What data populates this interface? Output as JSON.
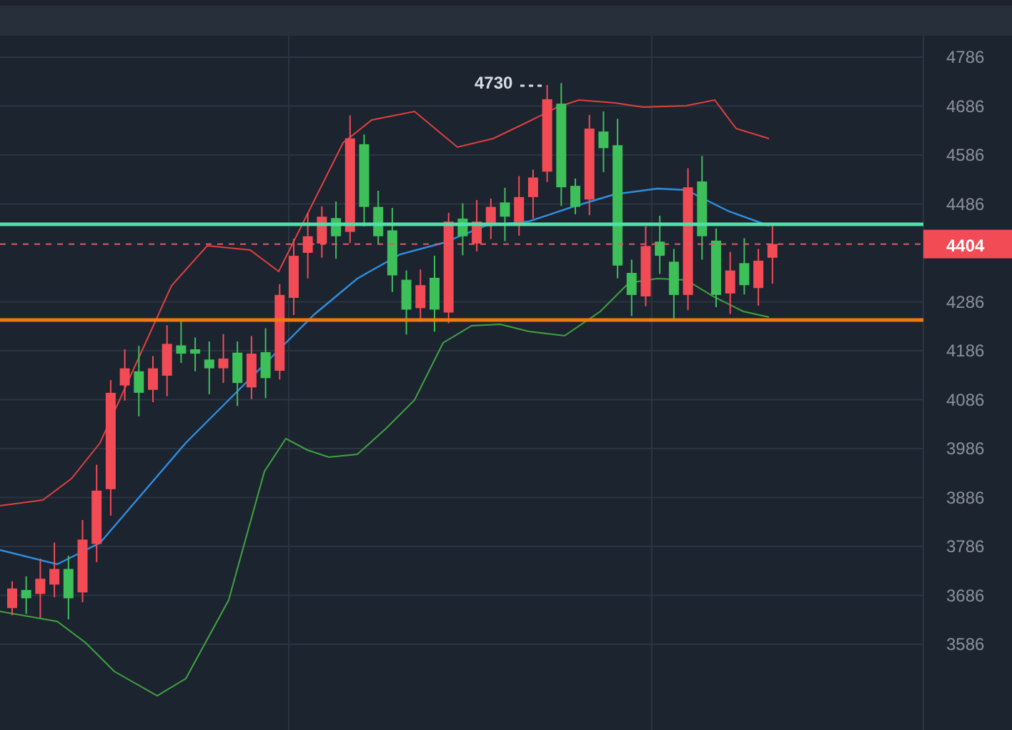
{
  "price_axis": {
    "ticks": [
      "4786",
      "4686",
      "4586",
      "4486",
      "4286",
      "4186",
      "4086",
      "3986",
      "3886",
      "3786",
      "3686",
      "3586"
    ]
  },
  "peak_label": {
    "text": "4730"
  },
  "last_price": {
    "label": "4404"
  }
}
